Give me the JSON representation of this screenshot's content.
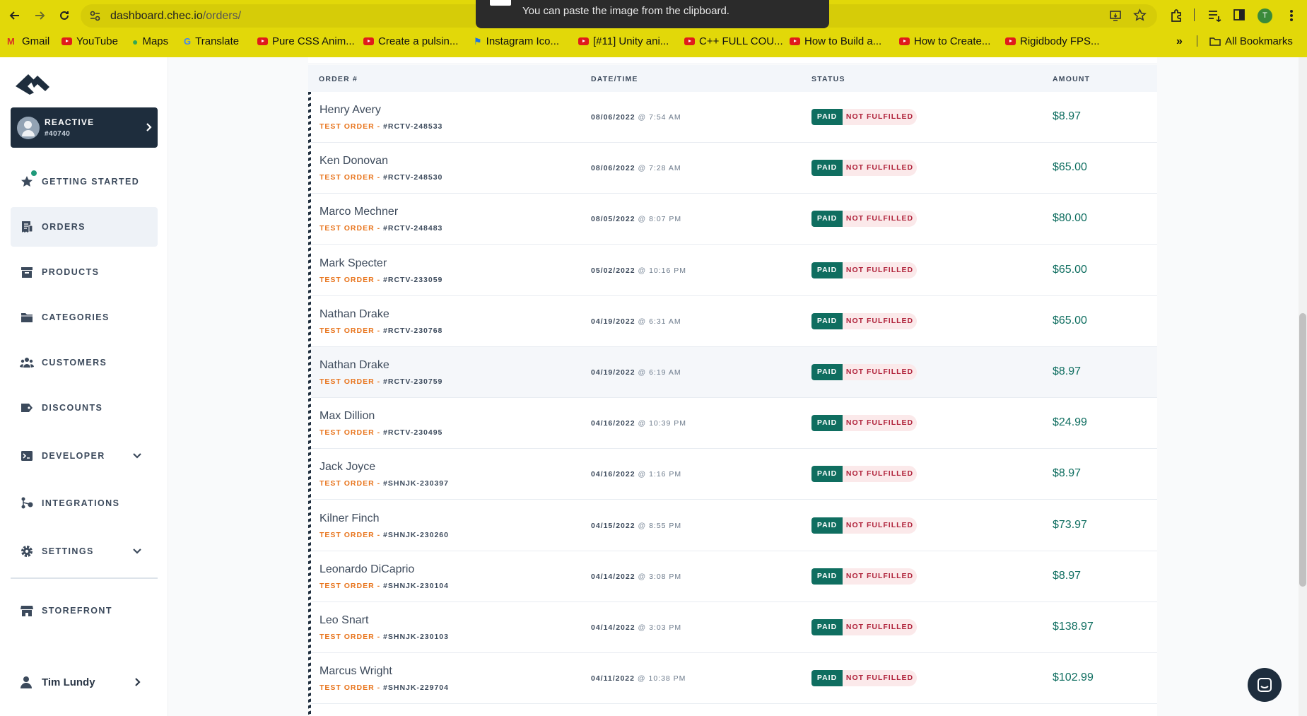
{
  "browser": {
    "url_host": "dashboard.chec.io",
    "url_path": "/orders/",
    "toast": "You can paste the image from the clipboard.",
    "profile_initial": "T",
    "bookmarks": [
      "Gmail",
      "YouTube",
      "Maps",
      "Translate",
      "Pure CSS Anim...",
      "Create a pulsin...",
      "Instagram Ico...",
      "[#11] Unity ani...",
      "C++ FULL COU...",
      "How to Build a...",
      "How to Create...",
      "Rigidbody FPS..."
    ],
    "all_bookmarks": "All Bookmarks"
  },
  "sidebar": {
    "merchant_name": "REACTIVE",
    "merchant_id": "#40740",
    "items": [
      {
        "label": "GETTING STARTED",
        "icon": "star-icon"
      },
      {
        "label": "ORDERS",
        "icon": "receipt-icon"
      },
      {
        "label": "PRODUCTS",
        "icon": "box-icon"
      },
      {
        "label": "CATEGORIES",
        "icon": "folder-icon"
      },
      {
        "label": "CUSTOMERS",
        "icon": "users-icon"
      },
      {
        "label": "DISCOUNTS",
        "icon": "tag-icon"
      },
      {
        "label": "DEVELOPER",
        "icon": "terminal-icon"
      },
      {
        "label": "INTEGRATIONS",
        "icon": "nodes-icon"
      },
      {
        "label": "SETTINGS",
        "icon": "gear-icon"
      },
      {
        "label": "STOREFRONT",
        "icon": "store-icon"
      }
    ],
    "user_name": "Tim Lundy"
  },
  "table": {
    "headers": {
      "order": "ORDER #",
      "datetime": "DATE/TIME",
      "status": "STATUS",
      "amount": "AMOUNT"
    },
    "rows": [
      {
        "customer": "Henry Avery",
        "tag": "TEST ORDER",
        "ref": "#RCTV-248533",
        "date": "08/06/2022",
        "time": "7:54 AM",
        "payment": "PAID",
        "fulfillment": "NOT FULFILLED",
        "amount": "$8.97"
      },
      {
        "customer": "Ken Donovan",
        "tag": "TEST ORDER",
        "ref": "#RCTV-248530",
        "date": "08/06/2022",
        "time": "7:28 AM",
        "payment": "PAID",
        "fulfillment": "NOT FULFILLED",
        "amount": "$65.00"
      },
      {
        "customer": "Marco Mechner",
        "tag": "TEST ORDER",
        "ref": "#RCTV-248483",
        "date": "08/05/2022",
        "time": "8:07 PM",
        "payment": "PAID",
        "fulfillment": "NOT FULFILLED",
        "amount": "$80.00"
      },
      {
        "customer": "Mark Specter",
        "tag": "TEST ORDER",
        "ref": "#RCTV-233059",
        "date": "05/02/2022",
        "time": "10:16 PM",
        "payment": "PAID",
        "fulfillment": "NOT FULFILLED",
        "amount": "$65.00"
      },
      {
        "customer": "Nathan Drake",
        "tag": "TEST ORDER",
        "ref": "#RCTV-230768",
        "date": "04/19/2022",
        "time": "6:31 AM",
        "payment": "PAID",
        "fulfillment": "NOT FULFILLED",
        "amount": "$65.00"
      },
      {
        "customer": "Nathan Drake",
        "tag": "TEST ORDER",
        "ref": "#RCTV-230759",
        "date": "04/19/2022",
        "time": "6:19 AM",
        "payment": "PAID",
        "fulfillment": "NOT FULFILLED",
        "amount": "$8.97"
      },
      {
        "customer": "Max Dillion",
        "tag": "TEST ORDER",
        "ref": "#RCTV-230495",
        "date": "04/16/2022",
        "time": "10:39 PM",
        "payment": "PAID",
        "fulfillment": "NOT FULFILLED",
        "amount": "$24.99"
      },
      {
        "customer": "Jack Joyce",
        "tag": "TEST ORDER",
        "ref": "#SHNJK-230397",
        "date": "04/16/2022",
        "time": "1:16 PM",
        "payment": "PAID",
        "fulfillment": "NOT FULFILLED",
        "amount": "$8.97"
      },
      {
        "customer": "Kilner Finch",
        "tag": "TEST ORDER",
        "ref": "#SHNJK-230260",
        "date": "04/15/2022",
        "time": "8:55 PM",
        "payment": "PAID",
        "fulfillment": "NOT FULFILLED",
        "amount": "$73.97"
      },
      {
        "customer": "Leonardo DiCaprio",
        "tag": "TEST ORDER",
        "ref": "#SHNJK-230104",
        "date": "04/14/2022",
        "time": "3:08 PM",
        "payment": "PAID",
        "fulfillment": "NOT FULFILLED",
        "amount": "$8.97"
      },
      {
        "customer": "Leo Snart",
        "tag": "TEST ORDER",
        "ref": "#SHNJK-230103",
        "date": "04/14/2022",
        "time": "3:03 PM",
        "payment": "PAID",
        "fulfillment": "NOT FULFILLED",
        "amount": "$138.97"
      },
      {
        "customer": "Marcus Wright",
        "tag": "TEST ORDER",
        "ref": "#SHNJK-229704",
        "date": "04/11/2022",
        "time": "10:38 PM",
        "payment": "PAID",
        "fulfillment": "NOT FULFILLED",
        "amount": "$102.99"
      }
    ]
  },
  "colors": {
    "chrome": "#e2d809",
    "navy": "#1e2d3d",
    "paid": "#0f6e60",
    "not_fulfilled_bg": "#fbe9ea",
    "not_fulfilled_text": "#b0233b",
    "test_order": "#e8741c"
  }
}
